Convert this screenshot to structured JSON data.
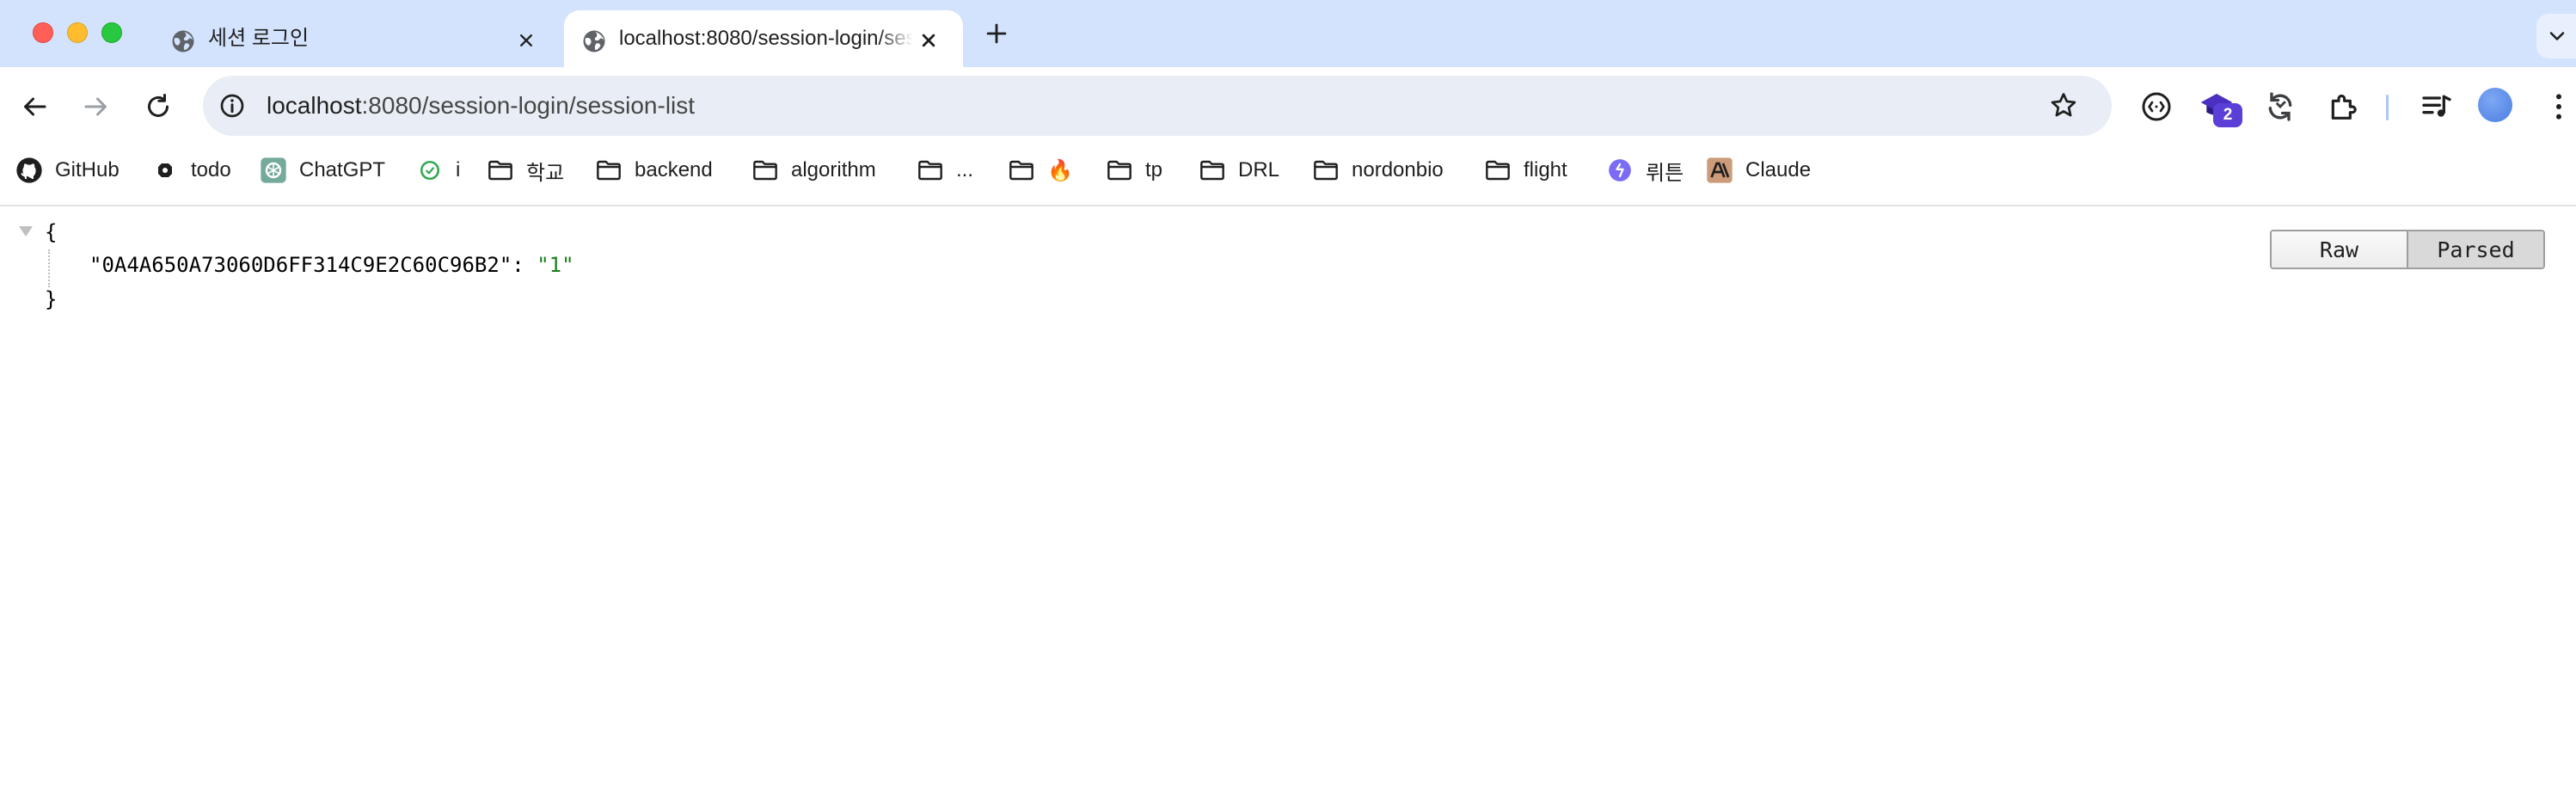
{
  "tabs": [
    {
      "title": "세션 로그인",
      "active": false,
      "favicon": "globe-icon"
    },
    {
      "title": "localhost:8080/session-login/session-list",
      "active": true,
      "favicon": "globe-icon"
    }
  ],
  "address_bar": {
    "host": "localhost",
    "path": ":8080/session-login/session-list"
  },
  "extensions": {
    "badge_count": "2"
  },
  "bookmarks": [
    {
      "label": "GitHub",
      "icon": "github-icon"
    },
    {
      "label": "todo",
      "icon": "todo-icon"
    },
    {
      "label": "ChatGPT",
      "icon": "chatgpt-icon"
    },
    {
      "label": "i",
      "icon": "green-circle-icon"
    },
    {
      "label": "학교",
      "icon": "folder-icon"
    },
    {
      "label": "backend",
      "icon": "folder-icon"
    },
    {
      "label": "algorithm",
      "icon": "folder-icon"
    },
    {
      "label": "...",
      "icon": "folder-icon"
    },
    {
      "label": "🔥",
      "icon": "folder-icon"
    },
    {
      "label": "tp",
      "icon": "folder-icon"
    },
    {
      "label": "DRL",
      "icon": "folder-icon"
    },
    {
      "label": "nordonbio",
      "icon": "folder-icon"
    },
    {
      "label": "flight",
      "icon": "folder-icon"
    },
    {
      "label": "뤼튼",
      "icon": "wrtn-icon"
    },
    {
      "label": "Claude",
      "icon": "claude-icon"
    }
  ],
  "json_view": {
    "open_brace": "{",
    "close_brace": "}",
    "entries": [
      {
        "key": "\"0A4A650A73060D6FF314C9E2C60C96B2\"",
        "separator": ": ",
        "value": "\"1\""
      }
    ]
  },
  "view_toggle": {
    "raw_label": "Raw",
    "parsed_label": "Parsed",
    "selected": "Parsed"
  },
  "colors": {
    "tabstrip": "#d3e3fd",
    "omnibox": "#e9eef6",
    "json_string": "#1a7f1a",
    "badge": "#5b3fd6"
  }
}
